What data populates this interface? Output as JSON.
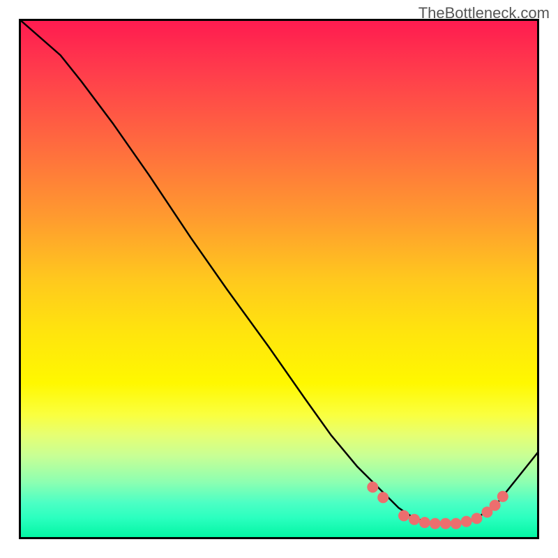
{
  "watermark": "TheBottleneck.com",
  "chart_data": {
    "type": "line",
    "title": "",
    "xlabel": "",
    "ylabel": "",
    "xlim": [
      0,
      100
    ],
    "ylim": [
      0,
      100
    ],
    "grid": false,
    "series": [
      {
        "name": "curve",
        "x": [
          0,
          8,
          12,
          18,
          25,
          33,
          40,
          48,
          55,
          60,
          65,
          70,
          73,
          76,
          80,
          84,
          88,
          92,
          96,
          100
        ],
        "y": [
          100,
          93,
          88,
          80,
          70,
          58,
          48,
          37,
          27,
          20,
          14,
          9,
          6,
          4,
          3,
          3,
          4,
          7,
          12,
          17
        ]
      }
    ],
    "markers": [
      {
        "x": 68,
        "y": 10
      },
      {
        "x": 70,
        "y": 8
      },
      {
        "x": 74,
        "y": 4.5
      },
      {
        "x": 76,
        "y": 3.8
      },
      {
        "x": 78,
        "y": 3.2
      },
      {
        "x": 80,
        "y": 3
      },
      {
        "x": 82,
        "y": 3
      },
      {
        "x": 84,
        "y": 3
      },
      {
        "x": 86,
        "y": 3.4
      },
      {
        "x": 88,
        "y": 4
      },
      {
        "x": 90,
        "y": 5.2
      },
      {
        "x": 91.5,
        "y": 6.5
      },
      {
        "x": 93,
        "y": 8.2
      }
    ],
    "marker_color": "#ec6e6e",
    "gradient_colors": {
      "top": "#ff1a50",
      "mid": "#fff800",
      "bottom": "#00f5a0"
    }
  }
}
